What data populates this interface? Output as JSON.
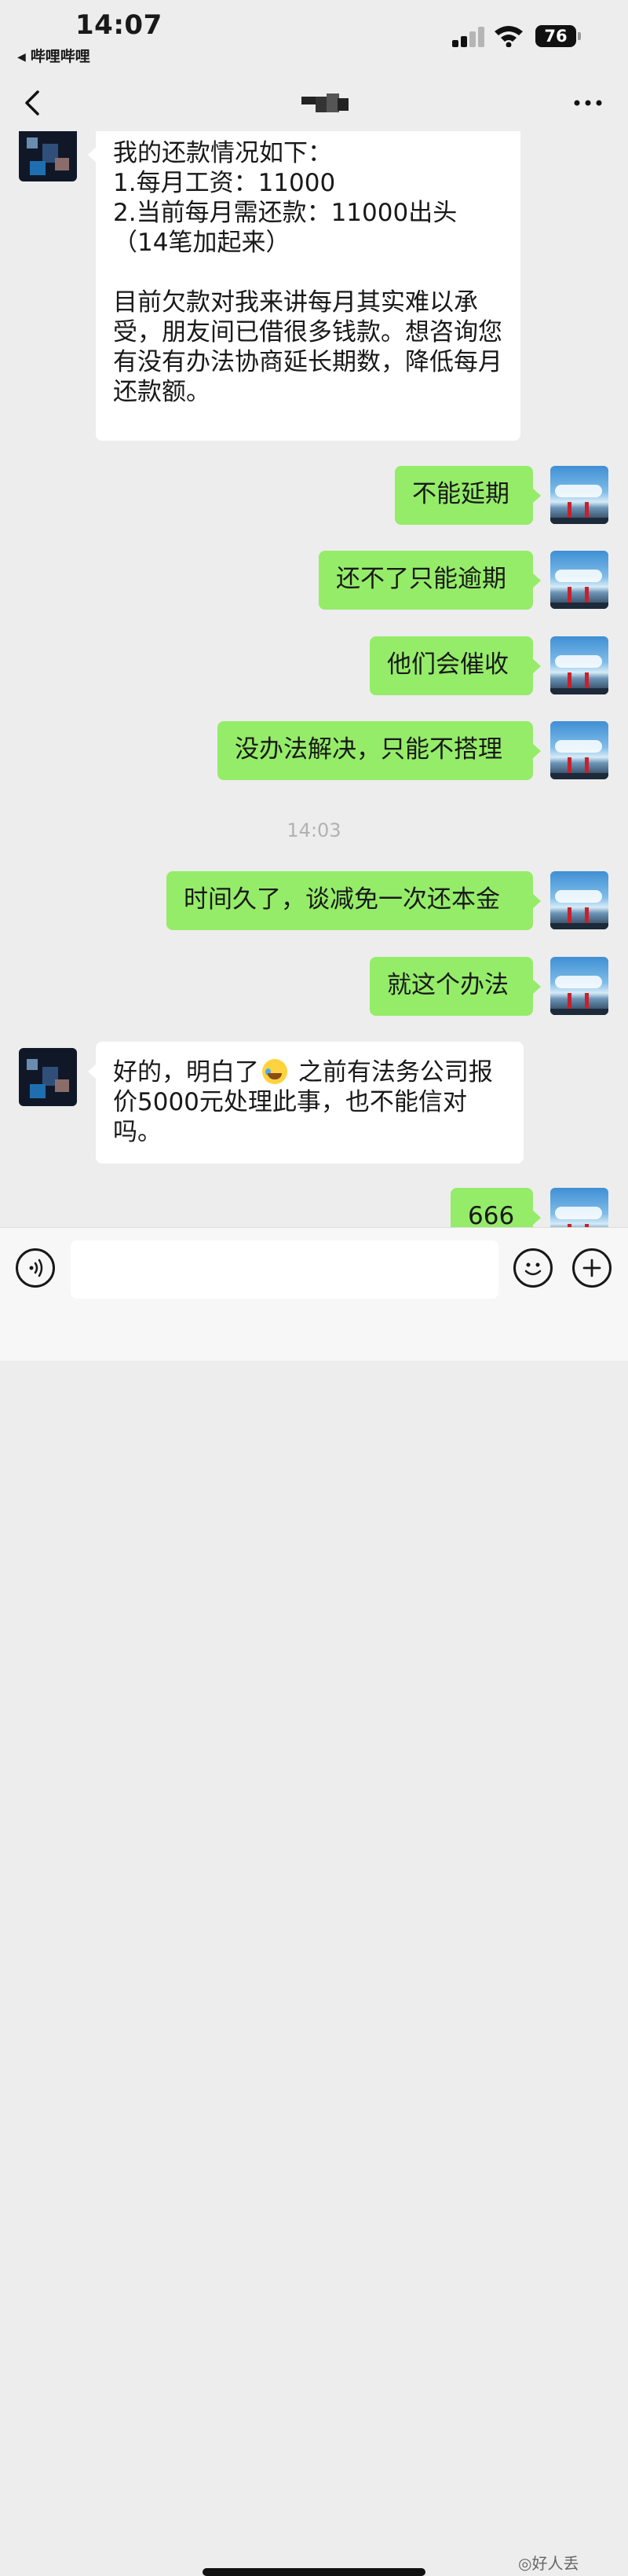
{
  "status_bar": {
    "time": "14:07",
    "back_to_app": "哔哩哔哩",
    "battery": "76"
  },
  "chat": {
    "messages": [
      {
        "side": "left",
        "text": "我的还款情况如下：\n1.每月工资：11000\n2.当前每月需还款：11000出头（14笔加起来）\n\n目前欠款对我来讲每月其实难以承受，朋友间已借很多钱款。想咨询您有没有办法协商延长期数，降低每月还款额。"
      },
      {
        "side": "right",
        "text": "不能延期"
      },
      {
        "side": "right",
        "text": "还不了只能逾期"
      },
      {
        "side": "right",
        "text": "他们会催收"
      },
      {
        "side": "right",
        "text": "没办法解决，只能不搭理"
      },
      {
        "side": "right",
        "text": "时间久了，谈减免一次还本金"
      },
      {
        "side": "right",
        "text": "就这个办法"
      },
      {
        "side": "left",
        "text_before_emoji": "好的，明白了",
        "emoji": "crying-laughing",
        "text_after_emoji": " 之前有法务公司报价5000元处理此事，也不能信对吗。"
      },
      {
        "side": "right",
        "text": "666"
      }
    ],
    "timestamp": "14:03"
  },
  "input_bar": {
    "value": ""
  },
  "watermark": "好人丢"
}
